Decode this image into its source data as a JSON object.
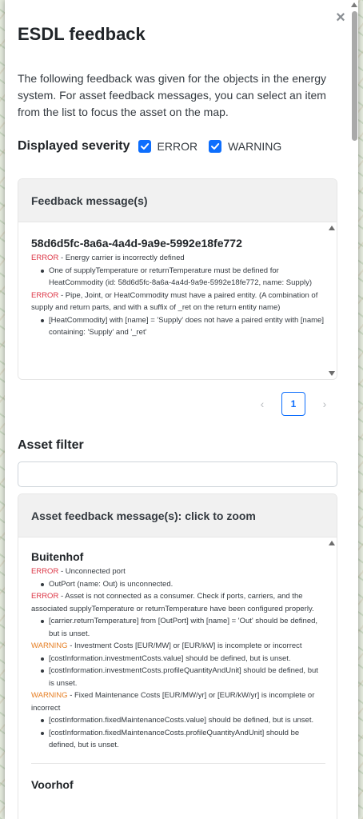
{
  "panel": {
    "title": "ESDL feedback",
    "close_icon": "×",
    "intro": "The following feedback was given for the objects in the energy system. For asset feedback messages, you can select an item from the list to focus the asset on the map."
  },
  "severity": {
    "label": "Displayed severity",
    "options": [
      {
        "label": "ERROR",
        "checked": true
      },
      {
        "label": "WARNING",
        "checked": true
      }
    ]
  },
  "feedback": {
    "header": "Feedback message(s)",
    "items": [
      {
        "asset": "58d6d5fc-8a6a-4a4d-9a9e-5992e18fe772",
        "messages": [
          {
            "severity": "ERROR",
            "text": " - Energy carrier is incorrectly defined",
            "details": [
              "One of supplyTemperature or returnTemperature must be defined for HeatCommodity (id: 58d6d5fc-8a6a-4a4d-9a9e-5992e18fe772, name: Supply)"
            ]
          },
          {
            "severity": "ERROR",
            "text": " - Pipe, Joint, or HeatCommodity must have a paired entity. (A combination of supply and return parts, and with a suffix of _ret on the return entity name)",
            "details": [
              "[HeatCommodity] with [name] = 'Supply' does not have a paired entity with [name] containing: 'Supply' and '_ret'"
            ]
          }
        ]
      }
    ],
    "pagination": {
      "prev": "‹",
      "current": "1",
      "next": "›"
    }
  },
  "asset_filter": {
    "label": "Asset filter",
    "value": "",
    "placeholder": ""
  },
  "asset_feedback": {
    "header": "Asset feedback message(s): click to zoom",
    "items": [
      {
        "asset": "Buitenhof",
        "messages": [
          {
            "severity": "ERROR",
            "text": " - Unconnected port",
            "details": [
              "OutPort (name: Out) is unconnected."
            ]
          },
          {
            "severity": "ERROR",
            "text": " - Asset is not connected as a consumer. Check if ports, carriers, and the associated supplyTemperature or returnTemperature have been configured properly.",
            "details": [
              "[carrier.returnTemperature] from [OutPort] with [name] = 'Out' should be defined, but is unset."
            ]
          },
          {
            "severity": "WARNING",
            "text": " - Investment Costs [EUR/MW] or [EUR/kW] is incomplete or incorrect",
            "details": [
              "[costInformation.investmentCosts.value] should be defined, but is unset.",
              "[costInformation.investmentCosts.profileQuantityAndUnit] should be defined, but is unset."
            ]
          },
          {
            "severity": "WARNING",
            "text": " - Fixed Maintenance Costs [EUR/MW/yr] or [EUR/kW/yr] is incomplete or incorrect",
            "details": [
              "[costInformation.fixedMaintenanceCosts.value] should be defined, but is unset.",
              "[costInformation.fixedMaintenanceCosts.profileQuantityAndUnit] should be defined, but is unset."
            ]
          }
        ]
      },
      {
        "asset": "Voorhof",
        "messages": []
      }
    ]
  },
  "colors": {
    "accent": "#0d6efd",
    "error": "#dc3545",
    "warning": "#e67e22"
  }
}
